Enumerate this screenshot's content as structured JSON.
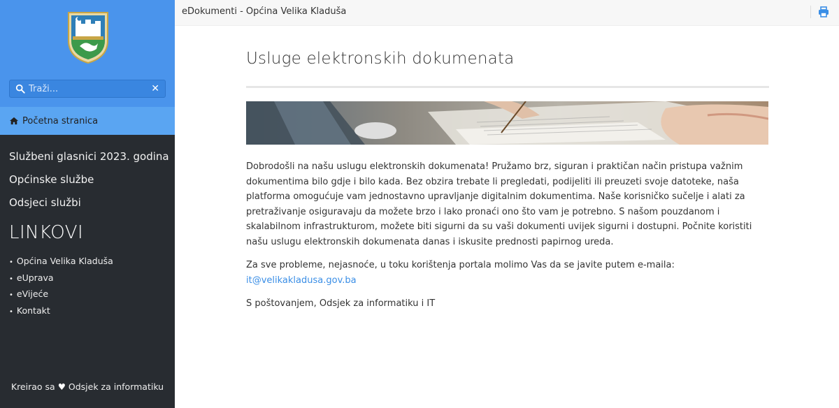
{
  "topbar": {
    "title": "eDokumenti - Općina Velika Kladuša"
  },
  "sidebar": {
    "search_placeholder": "Traži...",
    "home_label": "Početna stranica",
    "menu_items": [
      "Službeni glasnici 2023. godina",
      "Općinske službe",
      "Odsjeci službi"
    ],
    "links_title": "LINKOVI",
    "links": [
      "Općina Velika Kladuša",
      "eUprava",
      "eVijeće",
      "Kontakt"
    ],
    "footer": {
      "prefix": "Kreirao sa",
      "suffix": "Odsjek za informatiku"
    }
  },
  "main": {
    "title": "Usluge elektronskih dokumenata",
    "intro": "Dobrodošli na našu uslugu elektronskih dokumenata! Pružamo brz, siguran i praktičan način pristupa važnim dokumentima bilo gdje i bilo kada. Bez obzira trebate li pregledati, podijeliti ili preuzeti svoje datoteke, naša platforma omogućuje vam jednostavno upravljanje digitalnim dokumentima. Naše korisničko sučelje i alati za pretraživanje osiguravaju da možete brzo i lako pronaći ono što vam je potrebno. S našom pouzdanom i skalabilnom infrastrukturom, možete biti sigurni da su vaši dokumenti uvijek sigurni i dostupni. Počnite koristiti našu uslugu elektronskih dokumenata danas i iskusite prednosti papirnog ureda.",
    "support_text": "Za sve probleme, nejasnoće, u toku korištenja portala molimo Vas da se javite putem e-maila:",
    "support_email": "it@velikakladusa.gov.ba",
    "signature": "S poštovanjem, Odsjek za informatiku i IT"
  },
  "colors": {
    "sidebar_top": "#4a94ec",
    "sidebar_dark": "#282c31",
    "home_active": "#5aa5f2",
    "link": "#3a8ee6"
  },
  "icons": [
    "coat-of-arms-logo",
    "search-icon",
    "clear-icon",
    "home-icon",
    "heart-icon",
    "print-icon"
  ]
}
